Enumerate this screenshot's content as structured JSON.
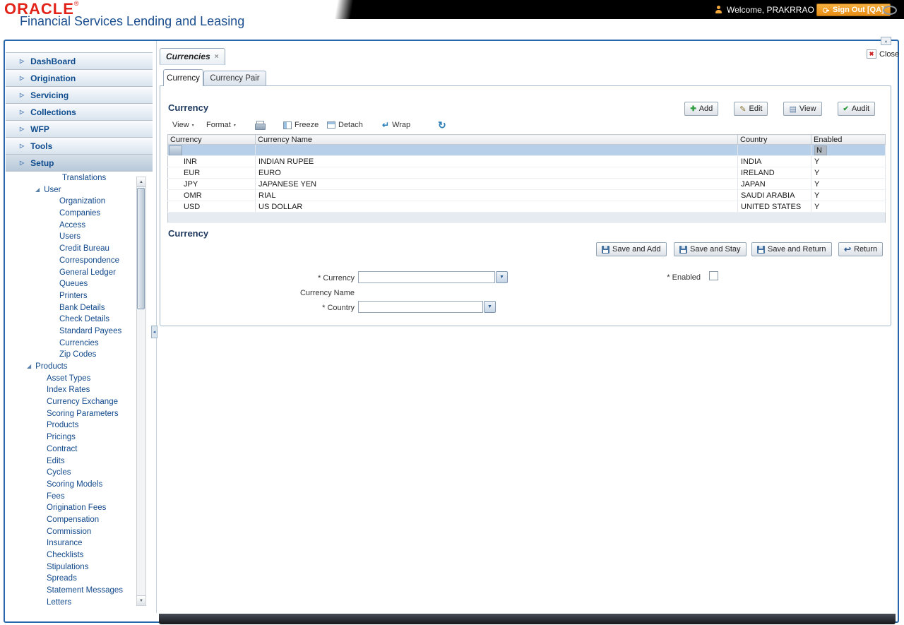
{
  "colors": {
    "brand_red": "#e2231a",
    "accent_blue": "#15428b",
    "signout_orange": "#ec9722",
    "selected_row": "#b7cfe8"
  },
  "icons": {
    "nav_chevron": "▷",
    "tree_expand": "◢",
    "dropdown_arrow": "▼",
    "menu_arrow": "▾",
    "welcome_caret": "▼",
    "close_x": "✖",
    "tab_close": "×",
    "add": "✚",
    "edit": "✎",
    "view": "▤",
    "audit": "✔",
    "wrap": "↵",
    "refresh": "↻",
    "return": "↩",
    "scroll_up": "▲",
    "scroll_down": "▼",
    "collapse_left": "◂",
    "collapse_up": "▴"
  },
  "header": {
    "logo": "ORACLE",
    "logo_r": "®",
    "product": "Financial Services Lending and Leasing",
    "welcome": "Welcome, PRAKRRAO",
    "sign_out": "Sign Out [QA]"
  },
  "nav": {
    "items": [
      "DashBoard",
      "Origination",
      "Servicing",
      "Collections",
      "WFP",
      "Tools",
      "Setup"
    ]
  },
  "tree": {
    "translations": "Translations",
    "user": {
      "label": "User",
      "children": [
        "Organization",
        "Companies",
        "Access",
        "Users",
        "Credit Bureau",
        "Correspondence",
        "General Ledger",
        "Queues",
        "Printers",
        "Bank Details",
        "Check Details",
        "Standard Payees",
        "Currencies",
        "Zip Codes"
      ]
    },
    "products": {
      "label": "Products",
      "children": [
        "Asset Types",
        "Index Rates",
        "Currency Exchange",
        "Scoring Parameters",
        "Products",
        "Pricings",
        "Contract",
        "Edits",
        "Cycles",
        "Scoring Models",
        "Fees",
        "Origination Fees",
        "Compensation",
        "Commission",
        "Insurance",
        "Checklists",
        "Stipulations",
        "Spreads",
        "Statement Messages",
        "Letters"
      ]
    }
  },
  "workspace": {
    "doc_tab": "Currencies",
    "close": "Close",
    "subtab_currency": "Currency",
    "subtab_currency_pair": "Currency Pair",
    "grid": {
      "title": "Currency",
      "actions": {
        "add": "Add",
        "edit": "Edit",
        "view": "View",
        "audit": "Audit"
      },
      "toolbar": {
        "view": "View",
        "format": "Format",
        "freeze": "Freeze",
        "detach": "Detach",
        "wrap": "Wrap"
      },
      "columns": [
        "Currency",
        "Currency Name",
        "Country",
        "Enabled"
      ],
      "rows": [
        {
          "currency": "",
          "name": "",
          "country": "",
          "enabled": "N"
        },
        {
          "currency": "INR",
          "name": "INDIAN RUPEE",
          "country": "INDIA",
          "enabled": "Y"
        },
        {
          "currency": "EUR",
          "name": "EURO",
          "country": "IRELAND",
          "enabled": "Y"
        },
        {
          "currency": "JPY",
          "name": "JAPANESE YEN",
          "country": "JAPAN",
          "enabled": "Y"
        },
        {
          "currency": "OMR",
          "name": "RIAL",
          "country": "SAUDI ARABIA",
          "enabled": "Y"
        },
        {
          "currency": "USD",
          "name": "US DOLLAR",
          "country": "UNITED STATES",
          "enabled": "Y"
        }
      ]
    },
    "form": {
      "title": "Currency",
      "buttons": {
        "save_add": "Save and Add",
        "save_stay": "Save and Stay",
        "save_return": "Save and Return",
        "return": "Return"
      },
      "labels": {
        "currency": "* Currency",
        "currency_name": "Currency Name",
        "country": "* Country",
        "enabled": "* Enabled"
      }
    }
  }
}
